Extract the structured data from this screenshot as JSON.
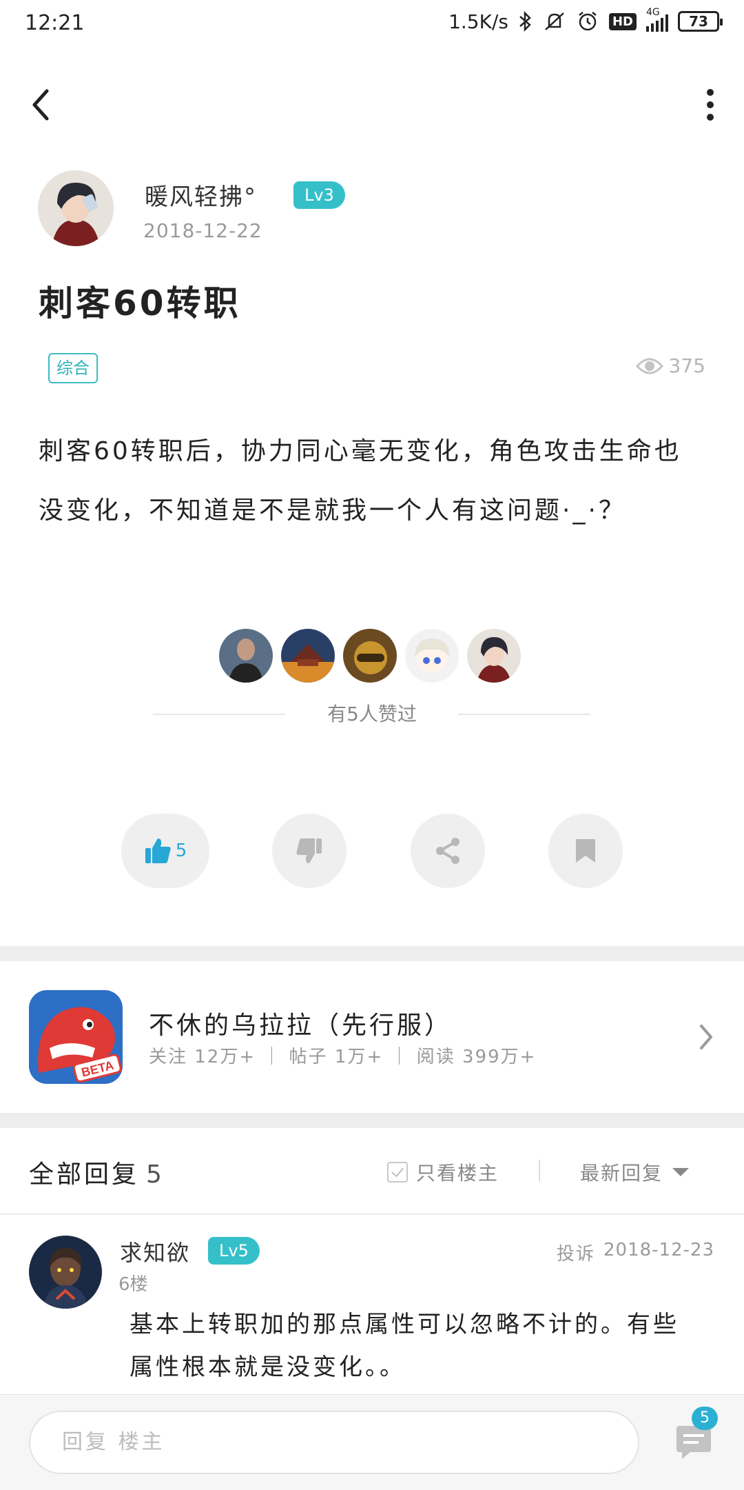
{
  "status_bar": {
    "time": "12:21",
    "network_speed": "1.5K/s",
    "net_type": "4G",
    "hd_label": "HD",
    "battery": "73",
    "icons": [
      "bluetooth-icon",
      "mute-icon",
      "alarm-icon",
      "hd-icon",
      "signal-icon",
      "battery-icon"
    ]
  },
  "header": {
    "back_icon": "back-arrow-icon",
    "more_icon": "more-vertical-icon"
  },
  "post": {
    "author": "暖风轻拂°",
    "author_level": "Lv3",
    "date": "2018-12-22",
    "title": "刺客60转职",
    "tag": "综合",
    "views": "375",
    "body": "刺客60转职后，协力同心毫无变化，角色攻击生命也没变化，不知道是不是就我一个人有这问题·_·？"
  },
  "likers": {
    "count_text": "有5人赞过",
    "avatars": 5
  },
  "actions": {
    "like_count": "5"
  },
  "game": {
    "name": "不休的乌拉拉（先行服）",
    "stats": "关注 12万+ ｜ 帖子 1万+ ｜ 阅读 399万+",
    "icon_badge": "BETA"
  },
  "replies": {
    "title": "全部回复",
    "count": "5",
    "only_owner": "只看楼主",
    "sort": "最新回复",
    "items": [
      {
        "name": "求知欲",
        "level": "Lv5",
        "report": "投诉",
        "date": "2018-12-23",
        "floor": "6楼",
        "text": "基本上转职加的那点属性可以忽略不计的。有些属性根本就是没变化。。"
      }
    ]
  },
  "bottom": {
    "placeholder": "回复  楼主",
    "comment_badge": "5"
  },
  "colors": {
    "accent": "#35c0c9",
    "like_blue": "#27a7d5",
    "badge_blue": "#2bb0d3"
  }
}
